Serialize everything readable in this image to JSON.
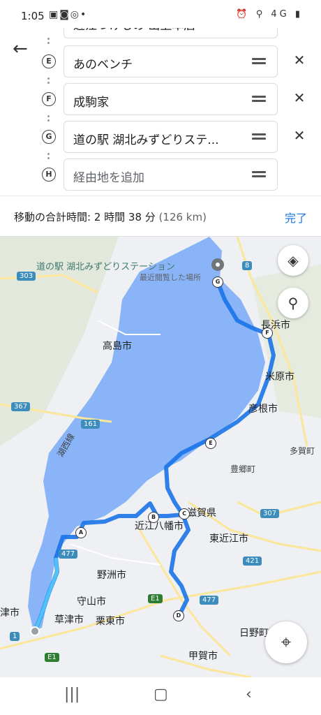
{
  "status": {
    "time": "1:05",
    "right": "⏰ ⚲ 4G ▮"
  },
  "header": {
    "back_icon": "arrow-left-icon"
  },
  "waypoints": [
    {
      "letter": "",
      "label": "近江つけもの 山上本店",
      "partial": true
    },
    {
      "letter": "E",
      "label": "あのベンチ"
    },
    {
      "letter": "F",
      "label": "成駒家"
    },
    {
      "letter": "G",
      "label": "道の駅 湖北みずどりステ..."
    }
  ],
  "add_stop": {
    "letter": "H",
    "placeholder": "経由地を追加"
  },
  "summary": {
    "text": "移動の合計時間: 2 時間 38 分",
    "distance": "(126 km)",
    "done_label": "完了"
  },
  "map": {
    "poi": {
      "name": "道の駅 湖北みずどりステーション",
      "sub": "最近閲覧した場所"
    },
    "places": [
      "高島市",
      "長浜市",
      "米原市",
      "彦根市",
      "多賀町",
      "豊郷町",
      "滋賀県",
      "近江八幡市",
      "東近江市",
      "野洲市",
      "守山市",
      "草津市",
      "栗東市",
      "日野町",
      "甲賀市",
      "津市"
    ],
    "route_markers": [
      "A",
      "B",
      "C",
      "D",
      "E",
      "F",
      "G"
    ],
    "road_shields": [
      "303",
      "8",
      "367",
      "161",
      "307",
      "477",
      "421",
      "477",
      "1",
      "E1",
      "E1"
    ],
    "line_label": "湖西線"
  },
  "colors": {
    "route": "#4285f4",
    "lake": "#8ab4f8",
    "accent": "#1a73e8"
  }
}
